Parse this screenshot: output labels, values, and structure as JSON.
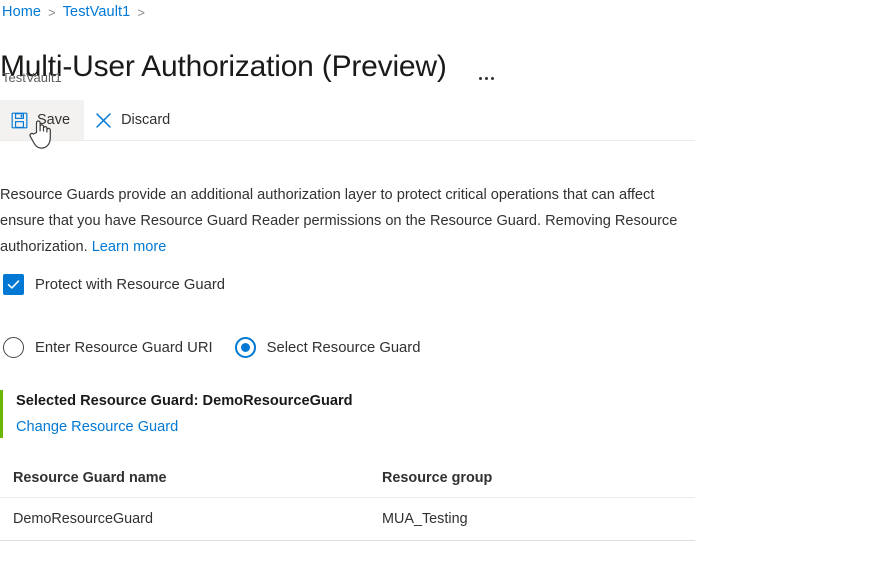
{
  "breadcrumb": {
    "items": [
      "Home",
      "TestVault1"
    ],
    "separator": ">"
  },
  "header": {
    "title": "Multi-User Authorization (Preview)",
    "subtitle": "TestVault1",
    "more_menu_label": "..."
  },
  "toolbar": {
    "save_label": "Save",
    "discard_label": "Discard"
  },
  "description": {
    "text": "Resource Guards provide an additional authorization layer to protect critical operations that can affect\nensure that you have Resource Guard Reader permissions on the Resource Guard. Removing Resource\nauthorization. ",
    "link_label": "Learn more"
  },
  "protect_checkbox": {
    "label": "Protect with Resource Guard",
    "checked": true
  },
  "guard_mode": {
    "option_uri_label": "Enter Resource Guard URI",
    "option_select_label": "Select Resource Guard",
    "selected": "Select Resource Guard"
  },
  "selected_guard": {
    "title": "Selected Resource Guard: DemoResourceGuard",
    "change_link_label": "Change Resource Guard"
  },
  "table": {
    "columns": [
      "Resource Guard name",
      "Resource group"
    ],
    "rows": [
      {
        "name": "DemoResourceGuard",
        "group": "MUA_Testing"
      }
    ]
  },
  "colors": {
    "accent_blue": "#0078d4",
    "success_green": "#6bb700",
    "text_primary": "#323130",
    "text_secondary": "#605e5c",
    "divider": "#edebe9"
  }
}
